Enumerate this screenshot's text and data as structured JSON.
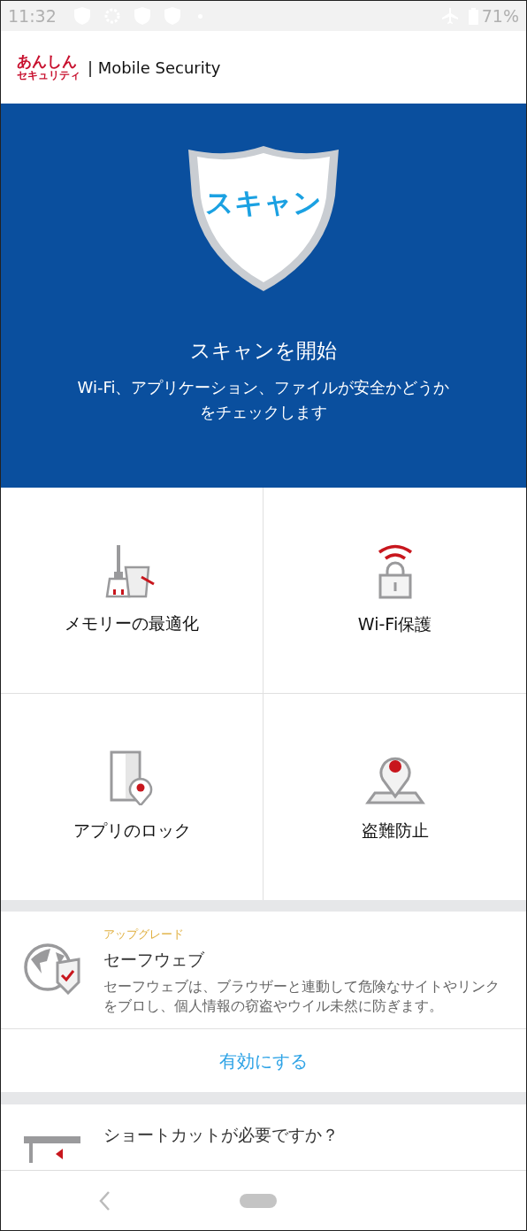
{
  "status_bar": {
    "time": "11:32",
    "battery": "71%"
  },
  "header": {
    "logo_line1": "あんしん",
    "logo_line2": "セキュリティ",
    "title": "| Mobile Security"
  },
  "scan": {
    "shield_label": "スキャン",
    "title": "スキャンを開始",
    "description": "Wi-Fi、アプリケーション、ファイルが安全かどうかをチェックします"
  },
  "features": [
    {
      "kind": "memory",
      "label": "メモリーの最適化"
    },
    {
      "kind": "wifi",
      "label": "Wi-Fi保護"
    },
    {
      "kind": "applock",
      "label": "アプリのロック"
    },
    {
      "kind": "theft",
      "label": "盗難防止"
    }
  ],
  "cards": [
    {
      "kind": "safeweb",
      "tag": "アップグレード",
      "title": "セーフウェブ",
      "description": "セーフウェブは、ブラウザーと連動して危険なサイトやリンクをブロし、個人情報の窃盗やウイル未然に防ぎます。",
      "action": "有効にする"
    },
    {
      "kind": "shortcut",
      "title": "ショートカットが必要ですか？"
    }
  ]
}
